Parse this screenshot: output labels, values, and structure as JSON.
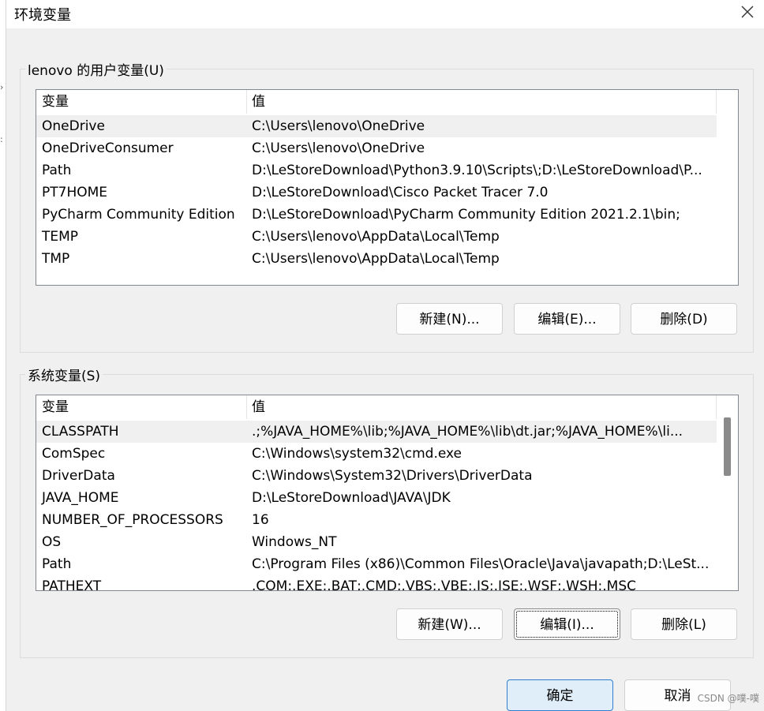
{
  "window": {
    "title": "环境变量"
  },
  "user_vars": {
    "group_label": "lenovo 的用户变量(U)",
    "columns": [
      "变量",
      "值"
    ],
    "rows": [
      {
        "name": "OneDrive",
        "value": "C:\\Users\\lenovo\\OneDrive"
      },
      {
        "name": "OneDriveConsumer",
        "value": "C:\\Users\\lenovo\\OneDrive"
      },
      {
        "name": "Path",
        "value": "D:\\LeStoreDownload\\Python3.9.10\\Scripts\\;D:\\LeStoreDownload\\P..."
      },
      {
        "name": "PT7HOME",
        "value": "D:\\LeStoreDownload\\Cisco Packet Tracer 7.0"
      },
      {
        "name": "PyCharm Community Edition",
        "value": "D:\\LeStoreDownload\\PyCharm Community Edition 2021.2.1\\bin;"
      },
      {
        "name": "TEMP",
        "value": "C:\\Users\\lenovo\\AppData\\Local\\Temp"
      },
      {
        "name": "TMP",
        "value": "C:\\Users\\lenovo\\AppData\\Local\\Temp"
      }
    ],
    "selected_row": "OneDrive",
    "buttons": {
      "new": "新建(N)...",
      "edit": "编辑(E)...",
      "delete": "删除(D)"
    }
  },
  "system_vars": {
    "group_label": "系统变量(S)",
    "columns": [
      "变量",
      "值"
    ],
    "rows": [
      {
        "name": "CLASSPATH",
        "value": ".;%JAVA_HOME%\\lib;%JAVA_HOME%\\lib\\dt.jar;%JAVA_HOME%\\li..."
      },
      {
        "name": "ComSpec",
        "value": "C:\\Windows\\system32\\cmd.exe"
      },
      {
        "name": "DriverData",
        "value": "C:\\Windows\\System32\\Drivers\\DriverData"
      },
      {
        "name": "JAVA_HOME",
        "value": "D:\\LeStoreDownload\\JAVA\\JDK"
      },
      {
        "name": "NUMBER_OF_PROCESSORS",
        "value": "16"
      },
      {
        "name": "OS",
        "value": "Windows_NT"
      },
      {
        "name": "Path",
        "value": "C:\\Program Files (x86)\\Common Files\\Oracle\\Java\\javapath;D:\\LeSt..."
      },
      {
        "name": "PATHEXT",
        "value": ".COM;.EXE;.BAT;.CMD;.VBS;.VBE;.JS;.JSE;.WSF;.WSH;.MSC"
      }
    ],
    "selected_row": "CLASSPATH",
    "buttons": {
      "new": "新建(W)...",
      "edit": "编辑(I)...",
      "delete": "删除(L)"
    }
  },
  "footer": {
    "ok": "确定",
    "cancel": "取消"
  },
  "watermark": "CSDN @噗-噗",
  "icons": {
    "close": "close-icon"
  },
  "colors": {
    "primary_button_border": "#2f7dd1",
    "primary_button_bg": "#e0eef9"
  }
}
